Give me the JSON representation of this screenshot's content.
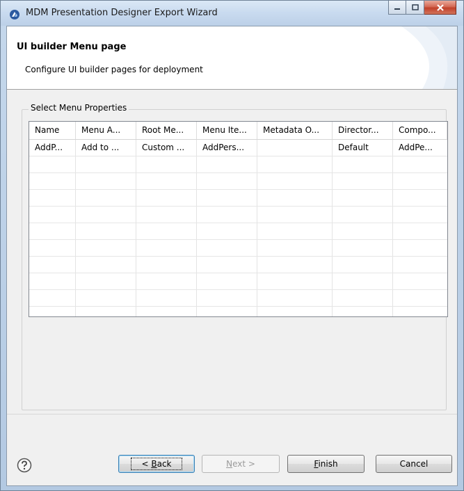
{
  "window": {
    "title": "MDM Presentation Designer Export Wizard",
    "icon": "app-icon",
    "controls": [
      "minimize-icon",
      "maximize-icon",
      "close-icon"
    ]
  },
  "header": {
    "title": "UI builder Menu page",
    "description": "Configure UI builder pages for deployment"
  },
  "group": {
    "label": "Select Menu Properties"
  },
  "table": {
    "columns": [
      "Name",
      "Menu A...",
      "Root Me...",
      "Menu Ite...",
      "Metadata O...",
      "Director...",
      "Compo..."
    ],
    "rows": [
      [
        "AddP...",
        "Add to ...",
        "Custom ...",
        "AddPers...",
        "",
        "Default",
        "AddPe..."
      ]
    ]
  },
  "footer": {
    "help_icon": "help-icon",
    "back": {
      "prefix": "< ",
      "accel": "B",
      "rest": "ack"
    },
    "next": {
      "accel": "N",
      "rest": "ext >"
    },
    "finish": {
      "accel": "F",
      "rest": "inish"
    },
    "cancel": "Cancel"
  },
  "colors": {
    "titlebar": "#c8daef",
    "client": "#f0f0f0",
    "close": "#c1412a"
  }
}
